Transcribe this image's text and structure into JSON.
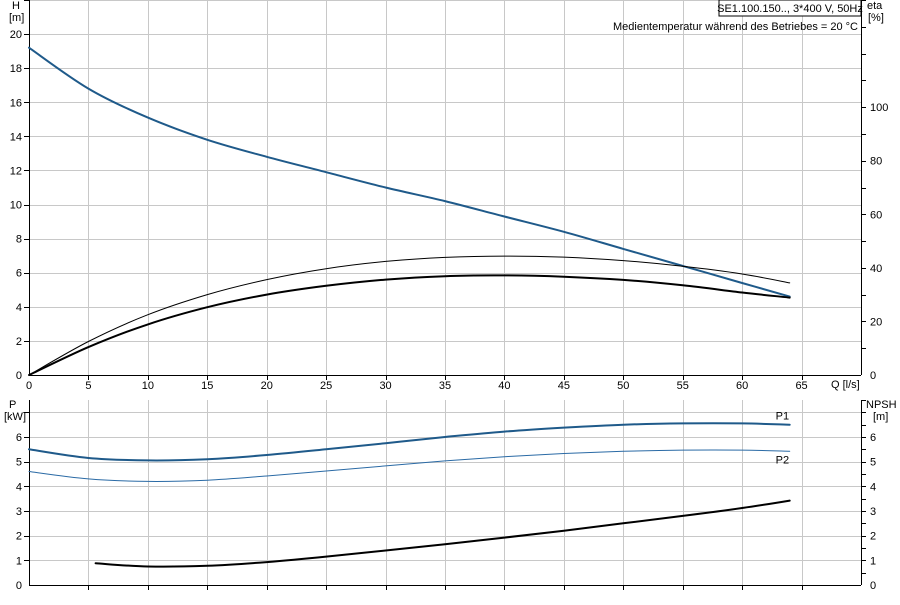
{
  "title_box": "SE1.100.150.., 3*400 V, 50Hz",
  "subtitle": "Medientemperatur während des Betriebes = 20 °C",
  "colors": {
    "grid": "#c8c8c8",
    "axis": "#000000",
    "head_curve": "#1f5a8a",
    "p1_curve": "#1f5a8a",
    "p2_curve": "#2a6aa5",
    "eta_curves": "#000000",
    "npsh_curve": "#000000"
  },
  "chart_data": [
    {
      "type": "line",
      "xlabel": "Q [l/s]",
      "ylabel_left": "H",
      "ylabel_left_unit": "[m]",
      "ylabel_right": "eta",
      "ylabel_right_unit": "[%]",
      "xlim": [
        0,
        70
      ],
      "xticks": [
        0,
        5,
        10,
        15,
        20,
        25,
        30,
        35,
        40,
        45,
        50,
        55,
        60,
        65
      ],
      "ylim_left": [
        0,
        22
      ],
      "yticks_left": [
        0,
        2,
        4,
        6,
        8,
        10,
        12,
        14,
        16,
        18,
        20
      ],
      "ylim_right": [
        0,
        140
      ],
      "yticks_right": [
        0,
        20,
        40,
        60,
        80,
        100
      ],
      "grid": true,
      "series": [
        {
          "axis": "left",
          "color": "#1f5a8a",
          "width": 2,
          "x": [
            0,
            5,
            10,
            15,
            20,
            25,
            30,
            35,
            40,
            45,
            50,
            55,
            60,
            64
          ],
          "y": [
            19.2,
            16.8,
            15.1,
            13.8,
            12.8,
            11.9,
            11.0,
            10.2,
            9.3,
            8.4,
            7.4,
            6.4,
            5.4,
            4.6
          ]
        },
        {
          "axis": "right",
          "color": "#000000",
          "width": 1,
          "x": [
            0,
            5,
            10,
            15,
            20,
            25,
            30,
            35,
            40,
            45,
            50,
            55,
            60,
            64
          ],
          "y": [
            0,
            12.5,
            22.5,
            30.0,
            35.6,
            39.7,
            42.4,
            43.9,
            44.4,
            44.0,
            42.7,
            40.6,
            37.7,
            34.4
          ]
        },
        {
          "axis": "right",
          "color": "#000000",
          "width": 2,
          "x": [
            0,
            5,
            10,
            15,
            20,
            25,
            30,
            35,
            40,
            45,
            50,
            55,
            60,
            64
          ],
          "y": [
            0,
            10.4,
            18.9,
            25.3,
            30.0,
            33.3,
            35.6,
            36.9,
            37.2,
            36.7,
            35.5,
            33.5,
            30.8,
            28.9
          ]
        }
      ]
    },
    {
      "type": "line",
      "xlim": [
        0,
        70
      ],
      "ylabel_left": "P",
      "ylabel_left_unit": "[kW]",
      "ylabel_right": "NPSH",
      "ylabel_right_unit": "[m]",
      "ylim_left": [
        0,
        7.5
      ],
      "yticks_left": [
        0,
        1,
        2,
        3,
        4,
        5,
        6
      ],
      "ylim_right": [
        0,
        7.5
      ],
      "yticks_right": [
        0,
        1,
        2,
        3,
        4,
        5,
        6
      ],
      "grid": true,
      "series": [
        {
          "name": "P1",
          "axis": "left",
          "color": "#1f5a8a",
          "width": 2,
          "x": [
            0,
            5,
            10,
            15,
            20,
            25,
            30,
            35,
            40,
            45,
            50,
            55,
            60,
            64
          ],
          "y": [
            5.5,
            5.15,
            5.05,
            5.1,
            5.27,
            5.5,
            5.75,
            6.0,
            6.22,
            6.38,
            6.5,
            6.55,
            6.55,
            6.5
          ]
        },
        {
          "name": "P2",
          "axis": "left",
          "color": "#2a6aa5",
          "width": 1,
          "x": [
            0,
            5,
            10,
            15,
            20,
            25,
            30,
            35,
            40,
            45,
            50,
            55,
            60,
            64
          ],
          "y": [
            4.6,
            4.3,
            4.2,
            4.25,
            4.42,
            4.62,
            4.83,
            5.03,
            5.2,
            5.33,
            5.42,
            5.47,
            5.47,
            5.42
          ]
        },
        {
          "axis": "right",
          "color": "#000000",
          "width": 2,
          "x": [
            5.6,
            10,
            15,
            20,
            25,
            30,
            35,
            40,
            45,
            50,
            55,
            60,
            64
          ],
          "y": [
            0.88,
            0.75,
            0.78,
            0.93,
            1.15,
            1.4,
            1.65,
            1.92,
            2.2,
            2.5,
            2.8,
            3.12,
            3.42
          ]
        }
      ]
    }
  ]
}
